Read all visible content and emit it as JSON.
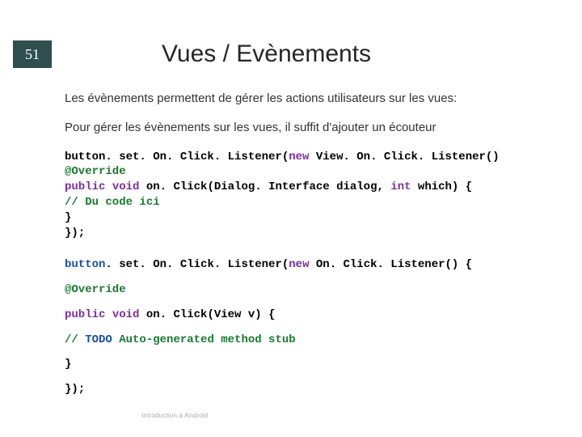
{
  "slideNumber": "51",
  "title": "Vues / Evènements",
  "para1": "Les évènements permettent de gérer les actions utilisateurs sur les vues:",
  "para2": "Pour gérer les évènements sur les vues, il suffit d'ajouter un écouteur",
  "code1": {
    "l1a": "button. set. On. Click. Listener(",
    "l1b": "new",
    "l1c": " View. On. Click. Listener()",
    "l2": "@Override",
    "l3a": "public",
    "l3b": " void",
    "l3c": " on. Click(Dialog. Interface dialog, ",
    "l3d": "int",
    "l3e": " which) {",
    "l4": "// Du code ici",
    "l5": "}",
    "l6": "});"
  },
  "code2": {
    "l1a": "button",
    "l1b": ". set. On. Click. Listener(",
    "l1c": "new",
    "l1d": " On. Click. Listener() {",
    "l2": "@Override",
    "l3a": "public",
    "l3b": " void",
    "l3c": " on. Click(View v) {",
    "l4a": "// ",
    "l4b": "TODO",
    "l4c": " Auto-generated method stub",
    "l5": "}",
    "l6": "});"
  },
  "footer": "Introduction à Android"
}
